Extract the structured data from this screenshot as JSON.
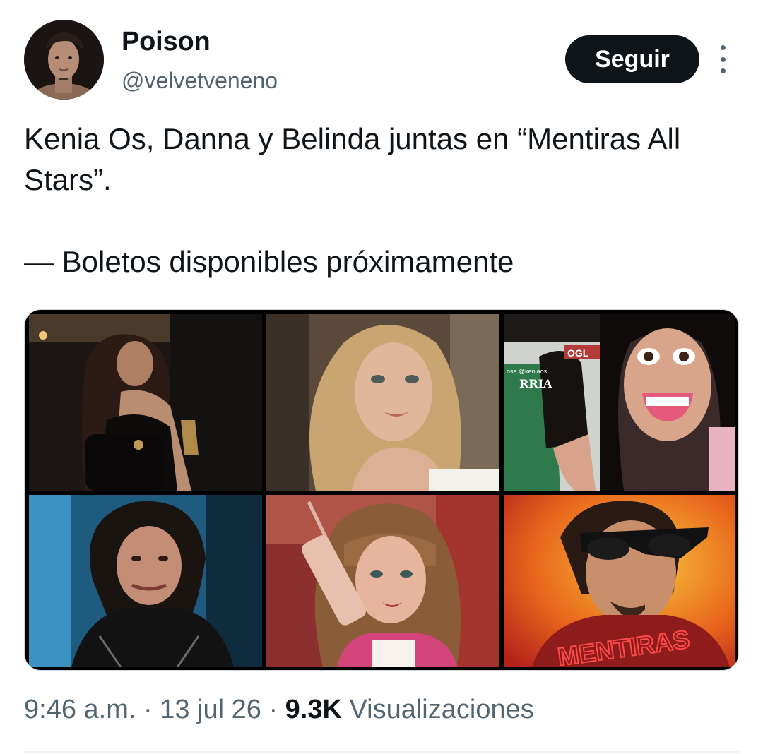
{
  "user": {
    "display_name": "Poison",
    "handle": "@velvetveneno"
  },
  "follow_button": {
    "label": "Seguir"
  },
  "tweet": {
    "line1": "Kenia Os, Danna y Belinda juntas en “Mentiras All Stars”.",
    "line2": "— Boletos disponibles próximamente"
  },
  "media": {
    "photos": [
      {
        "id": "photo-1"
      },
      {
        "id": "photo-2"
      },
      {
        "id": "photo-3",
        "overlay_text": "ose @keniaos",
        "jersey_text": "RRIA",
        "tag_text": "OGL"
      },
      {
        "id": "photo-4"
      },
      {
        "id": "photo-5"
      },
      {
        "id": "photo-6",
        "logo_text": "MENTIRAS"
      }
    ]
  },
  "meta": {
    "time": "9:46 a.m.",
    "separator": "·",
    "date": "13 jul 26",
    "views_count": "9.3K",
    "views_label": "Visualizaciones"
  },
  "colors": {
    "text": "#0f1419",
    "secondary": "#536471",
    "button_bg": "#0f1419",
    "button_text": "#ffffff",
    "divider": "#eff3f4"
  },
  "icons": {
    "more": "more-vertical-icon"
  }
}
